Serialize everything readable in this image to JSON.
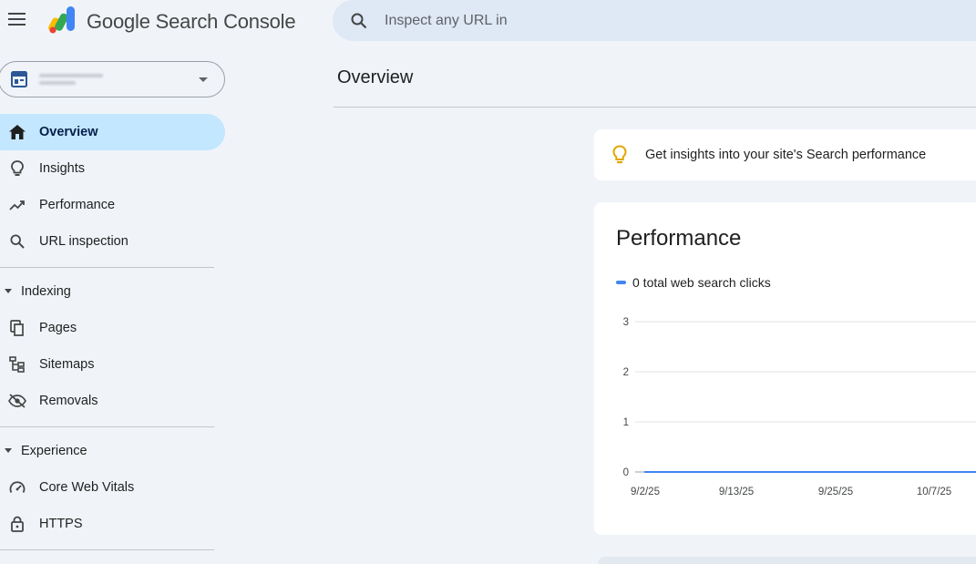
{
  "header": {
    "brand": "Google Search Console",
    "search_placeholder": "Inspect any URL in"
  },
  "property": {
    "icon": "property-icon"
  },
  "sidebar": {
    "items": [
      {
        "label": "Overview",
        "icon": "home-icon",
        "active": true
      },
      {
        "label": "Insights",
        "icon": "lightbulb-icon"
      },
      {
        "label": "Performance",
        "icon": "trending-up-icon"
      },
      {
        "label": "URL inspection",
        "icon": "search-icon"
      }
    ],
    "indexing": {
      "label": "Indexing",
      "items": [
        {
          "label": "Pages",
          "icon": "pages-icon"
        },
        {
          "label": "Sitemaps",
          "icon": "sitemap-icon"
        },
        {
          "label": "Removals",
          "icon": "eye-off-icon"
        }
      ]
    },
    "experience": {
      "label": "Experience",
      "items": [
        {
          "label": "Core Web Vitals",
          "icon": "speedometer-icon"
        },
        {
          "label": "HTTPS",
          "icon": "lock-icon"
        }
      ]
    }
  },
  "main": {
    "title": "Overview",
    "insight_text": "Get insights into your site's Search performance",
    "performance": {
      "title": "Performance",
      "legend": "0 total web search clicks"
    }
  },
  "colors": {
    "accent": "#4285f4",
    "active_bg": "#c2e7ff",
    "bulb": "#e2a500"
  },
  "chart_data": {
    "type": "line",
    "x": [
      "9/2/25",
      "9/13/25",
      "9/25/25",
      "10/7/25"
    ],
    "series": [
      {
        "values": [
          0,
          0,
          0,
          0
        ]
      }
    ],
    "y_ticks": [
      "3",
      "2",
      "1",
      "0"
    ],
    "ylim": [
      0,
      3
    ],
    "grid": true
  }
}
